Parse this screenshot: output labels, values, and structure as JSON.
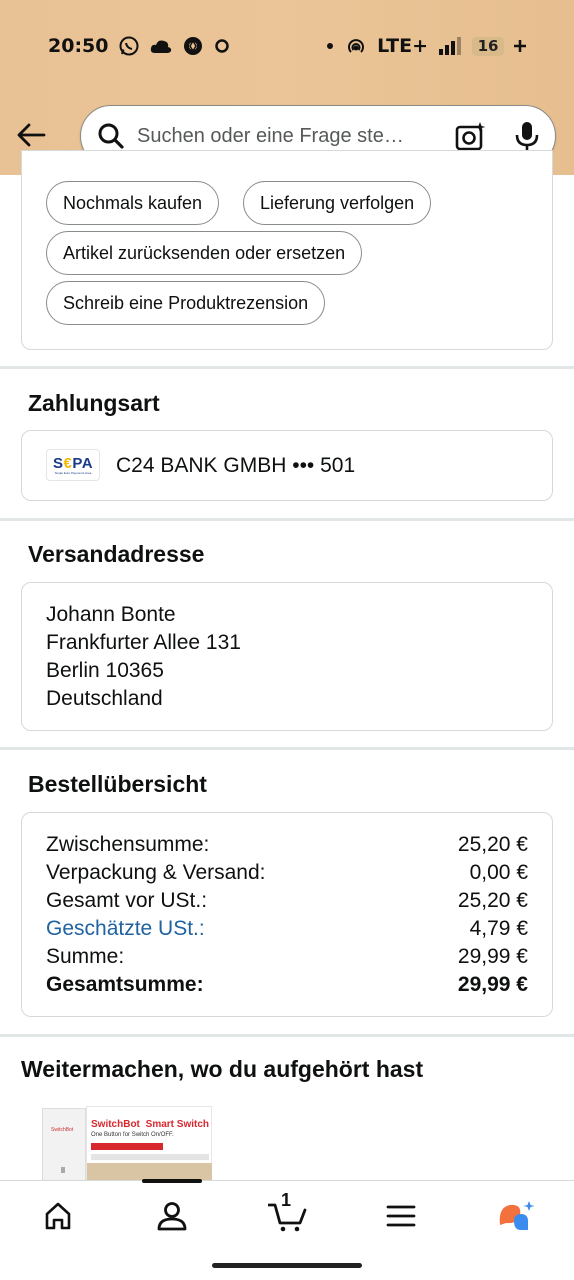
{
  "status_bar": {
    "time": "20:50",
    "network": "LTE+",
    "battery": "16",
    "icons": [
      "whatsapp-icon",
      "cloud-icon",
      "settings-badge-icon",
      "circle-icon",
      "dot-icon",
      "hotspot-icon",
      "signal-icon",
      "battery-icon"
    ]
  },
  "search": {
    "placeholder": "Suchen oder eine Frage ste…"
  },
  "actions": {
    "buy_again": "Nochmals kaufen",
    "track_delivery": "Lieferung verfolgen",
    "return_replace": "Artikel zurücksenden oder ersetzen",
    "write_review": "Schreib eine Produktrezension"
  },
  "payment": {
    "title": "Zahlungsart",
    "logo_text": "SEPA",
    "bank": "C24 BANK GMBH ••• 501"
  },
  "shipping": {
    "title": "Versandadresse",
    "lines": [
      "Johann Bonte",
      "Frankfurter Allee 131",
      "Berlin 10365",
      "Deutschland"
    ]
  },
  "summary": {
    "title": "Bestellübersicht",
    "rows": [
      {
        "label": "Zwischensumme:",
        "value": "25,20 €"
      },
      {
        "label": "Verpackung & Versand:",
        "value": "0,00 €"
      },
      {
        "label": "Gesamt vor USt.:",
        "value": "25,20 €"
      },
      {
        "label": "Geschätzte USt.:",
        "value": "4,79 €"
      },
      {
        "label": "Summe:",
        "value": "29,99 €"
      },
      {
        "label": "Gesamtsumme:",
        "value": "29,99 €"
      }
    ]
  },
  "continue": {
    "title": "Weitermachen, wo du aufgehört hast",
    "product_brand": "SwitchBot",
    "product_name": "Smart Switch",
    "product_tagline": "One Button for Switch On/OFF."
  },
  "nav": {
    "cart_count": "1",
    "active_index": 1
  },
  "colors": {
    "header_bg": "#ebc597",
    "link": "#2162a1",
    "border": "#d5d9d9",
    "assistant_orange": "#f3713c",
    "assistant_blue": "#3c8cf0"
  }
}
